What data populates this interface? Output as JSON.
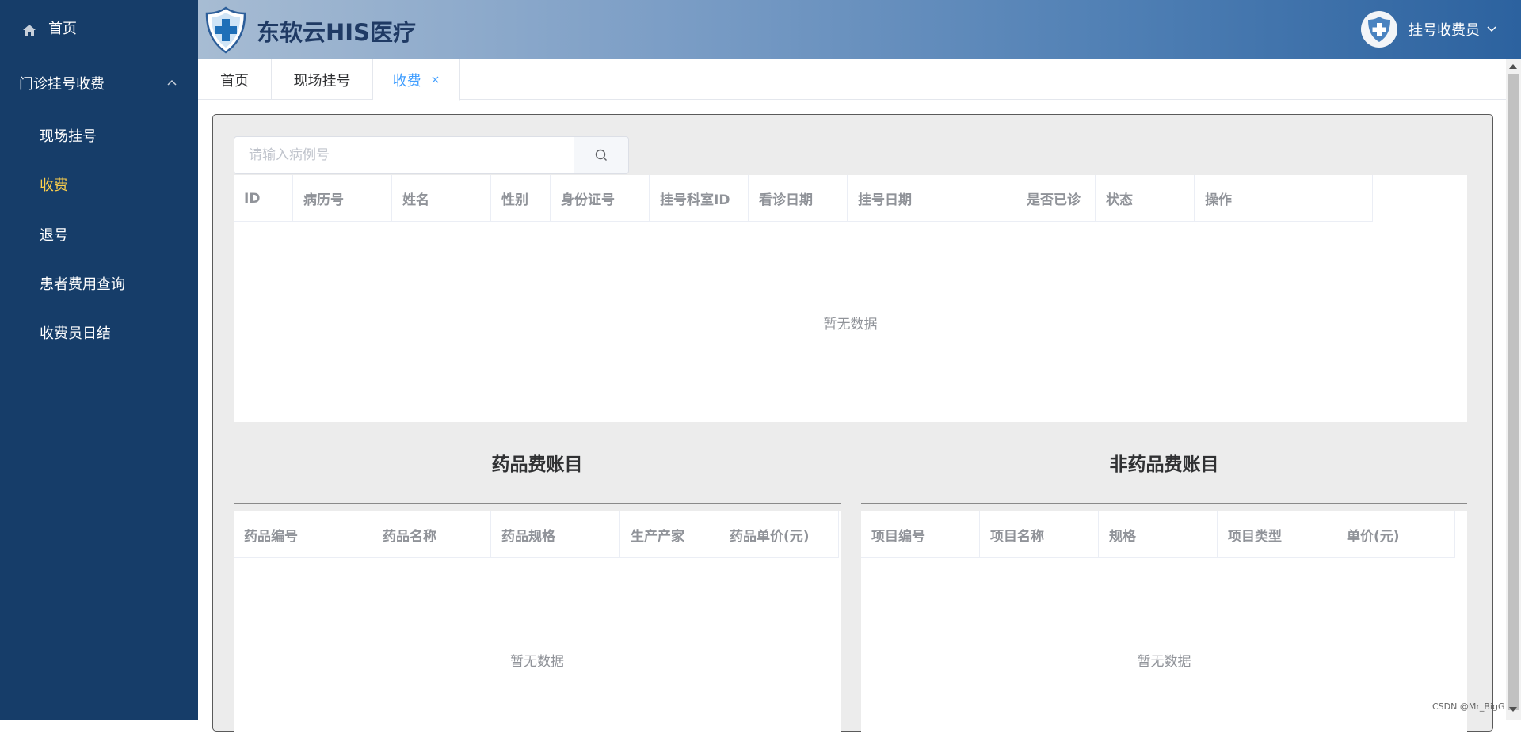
{
  "sidebar": {
    "home_label": "首页",
    "group_label": "门诊挂号收费",
    "items": [
      {
        "label": "现场挂号"
      },
      {
        "label": "收费"
      },
      {
        "label": "退号"
      },
      {
        "label": "患者费用查询"
      },
      {
        "label": "收费员日结"
      }
    ],
    "active_color": "#ffd04b"
  },
  "header": {
    "app_title": "东软云HIS医疗",
    "user_label": "挂号收费员"
  },
  "tabs": [
    {
      "label": "首页"
    },
    {
      "label": "现场挂号"
    },
    {
      "label": "收费",
      "close": "×"
    }
  ],
  "search": {
    "placeholder": "请输入病例号",
    "value": ""
  },
  "main_table": {
    "columns": [
      "ID",
      "病历号",
      "姓名",
      "性别",
      "身份证号",
      "挂号科室ID",
      "看诊日期",
      "挂号日期",
      "是否已诊",
      "状态",
      "操作"
    ],
    "empty_text": "暂无数据"
  },
  "drug_section": {
    "title": "药品费账目",
    "columns": [
      "药品编号",
      "药品名称",
      "药品规格",
      "生产产家",
      "药品单价(元)"
    ],
    "empty_text": "暂无数据"
  },
  "nondrug_section": {
    "title": "非药品费账目",
    "columns": [
      "项目编号",
      "项目名称",
      "规格",
      "项目类型",
      "单价(元)"
    ],
    "empty_text": "暂无数据"
  },
  "watermark": "CSDN @Mr_BigG",
  "colors": {
    "sidebar_bg": "#163d69",
    "tab_active": "#409eff",
    "panel_bg": "#ececec"
  }
}
